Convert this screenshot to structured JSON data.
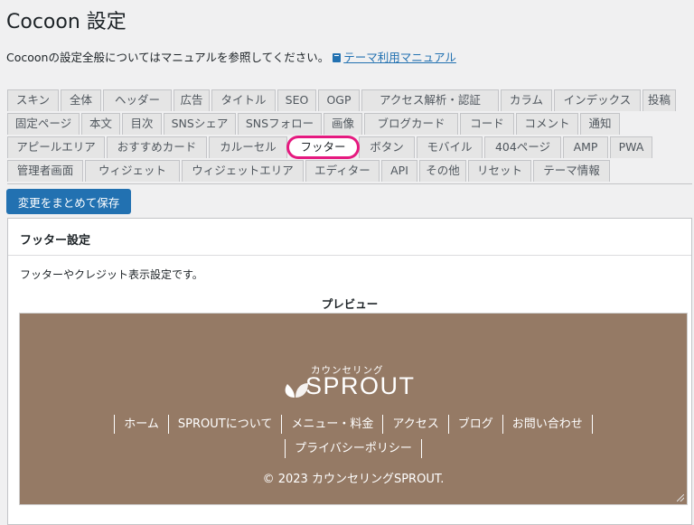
{
  "page": {
    "title": "Cocoon 設定",
    "intro_text": "Cocoonの設定全般についてはマニュアルを参照してください。",
    "manual_link": "テーマ利用マニュアル"
  },
  "tabs": {
    "rows": [
      [
        "スキン",
        "全体",
        "ヘッダー",
        "広告",
        "タイトル",
        "SEO",
        "OGP",
        "アクセス解析・認証",
        "カラム",
        "インデックス",
        "投稿"
      ],
      [
        "固定ページ",
        "本文",
        "目次",
        "SNSシェア",
        "SNSフォロー",
        "画像",
        "ブログカード",
        "コード",
        "コメント",
        "通知"
      ],
      [
        "アピールエリア",
        "おすすめカード",
        "カルーセル",
        "フッター",
        "ボタン",
        "モバイル",
        "404ページ",
        "AMP",
        "PWA"
      ],
      [
        "管理者画面",
        "ウィジェット",
        "ウィジェットエリア",
        "エディター",
        "API",
        "その他",
        "リセット",
        "テーマ情報"
      ]
    ],
    "active": "フッター",
    "highlight_color": "#e5197f"
  },
  "save_button": "変更をまとめて保存",
  "panel": {
    "title": "フッター設定",
    "description": "フッターやクレジット表示設定です。",
    "preview_label": "プレビュー"
  },
  "preview": {
    "background": "#957a65",
    "brand_kana": "カウンセリング",
    "brand_name": "SPROUT",
    "nav_rows": [
      [
        "ホーム",
        "SPROUTについて",
        "メニュー・料金",
        "アクセス",
        "ブログ",
        "お問い合わせ"
      ],
      [
        "プライバシーポリシー"
      ]
    ],
    "copyright": "© 2023 カウンセリングSPROUT."
  },
  "colors": {
    "accent": "#2271b1",
    "page_bg": "#f0f0f1"
  }
}
